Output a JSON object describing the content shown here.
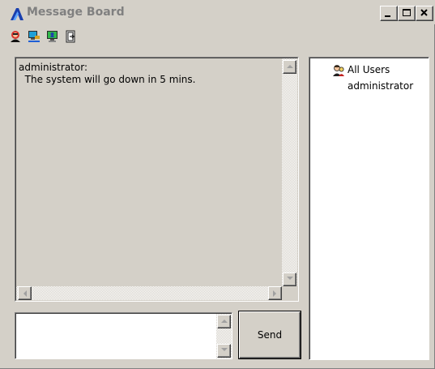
{
  "window": {
    "title": "Message Board",
    "controls": [
      "minimize",
      "maximize",
      "close"
    ]
  },
  "toolbar": {
    "tools": [
      {
        "icon": "user-red-icon"
      },
      {
        "icon": "monitor-network-icon"
      },
      {
        "icon": "monitor-users-icon"
      },
      {
        "icon": "exit-door-icon"
      }
    ]
  },
  "messages": {
    "text": "administrator:\n  The system will go down in 5 mins."
  },
  "input": {
    "value": "",
    "placeholder": ""
  },
  "send_button": {
    "label": "Send"
  },
  "users": {
    "group_label": "All Users",
    "items": [
      "administrator"
    ]
  },
  "colors": {
    "window_bg": "#d4d0c8",
    "title_text": "#808080",
    "list_bg": "#ffffff"
  }
}
